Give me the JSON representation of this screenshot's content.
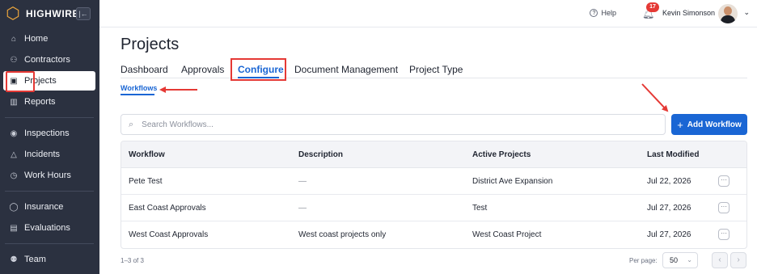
{
  "brand": {
    "name": "HIGHWIRE",
    "logo_letter": "H",
    "logo_icon": "hexagon-icon",
    "collapse_icon": "collapse-sidebar-icon"
  },
  "sidebar": {
    "items": [
      {
        "label": "Home",
        "icon": "home-icon",
        "glyph": "⌂"
      },
      {
        "label": "Contractors",
        "icon": "contractors-icon",
        "glyph": "⚇"
      },
      {
        "label": "Projects",
        "icon": "projects-icon",
        "glyph": "▣",
        "active": true
      },
      {
        "label": "Reports",
        "icon": "reports-icon",
        "glyph": "▥"
      },
      {
        "label": "Inspections",
        "icon": "eye-icon",
        "glyph": "◉"
      },
      {
        "label": "Incidents",
        "icon": "warning-icon",
        "glyph": "△"
      },
      {
        "label": "Work Hours",
        "icon": "clock-icon",
        "glyph": "◷"
      },
      {
        "label": "Insurance",
        "icon": "shield-icon",
        "glyph": "◯"
      },
      {
        "label": "Evaluations",
        "icon": "clipboard-icon",
        "glyph": "▤"
      },
      {
        "label": "Team",
        "icon": "team-icon",
        "glyph": "⚉"
      }
    ]
  },
  "topbar": {
    "help_label": "Help",
    "notifications_count": "17",
    "user_name": "Kevin Simonson"
  },
  "page": {
    "title": "Projects",
    "tabs": [
      {
        "label": "Dashboard"
      },
      {
        "label": "Approvals"
      },
      {
        "label": "Configure",
        "active": true
      },
      {
        "label": "Document Management"
      },
      {
        "label": "Project Type"
      }
    ],
    "subtab": "Workflows"
  },
  "search": {
    "placeholder": "Search Workflows...",
    "value": ""
  },
  "add_button": {
    "label": "Add Workflow"
  },
  "table": {
    "columns": [
      "Workflow",
      "Description",
      "Active Projects",
      "Last Modified"
    ],
    "rows": [
      {
        "workflow": "Pete Test",
        "description": "—",
        "active_projects": "District Ave Expansion",
        "last_modified": "Jul 22, 2026"
      },
      {
        "workflow": "East Coast Approvals",
        "description": "—",
        "active_projects": "Test",
        "last_modified": "Jul 27, 2026"
      },
      {
        "workflow": "West Coast Approvals",
        "description": "West coast projects only",
        "active_projects": "West Coast Project",
        "last_modified": "Jul 27, 2026"
      }
    ]
  },
  "pagination": {
    "count_text": "1–3 of 3",
    "per_page_label": "Per page:",
    "per_page_value": "50"
  },
  "colors": {
    "sidebar_bg": "#2b3140",
    "accent": "#1a66d4",
    "annotation_red": "#e53935",
    "brand_orange": "#f0a83c"
  }
}
